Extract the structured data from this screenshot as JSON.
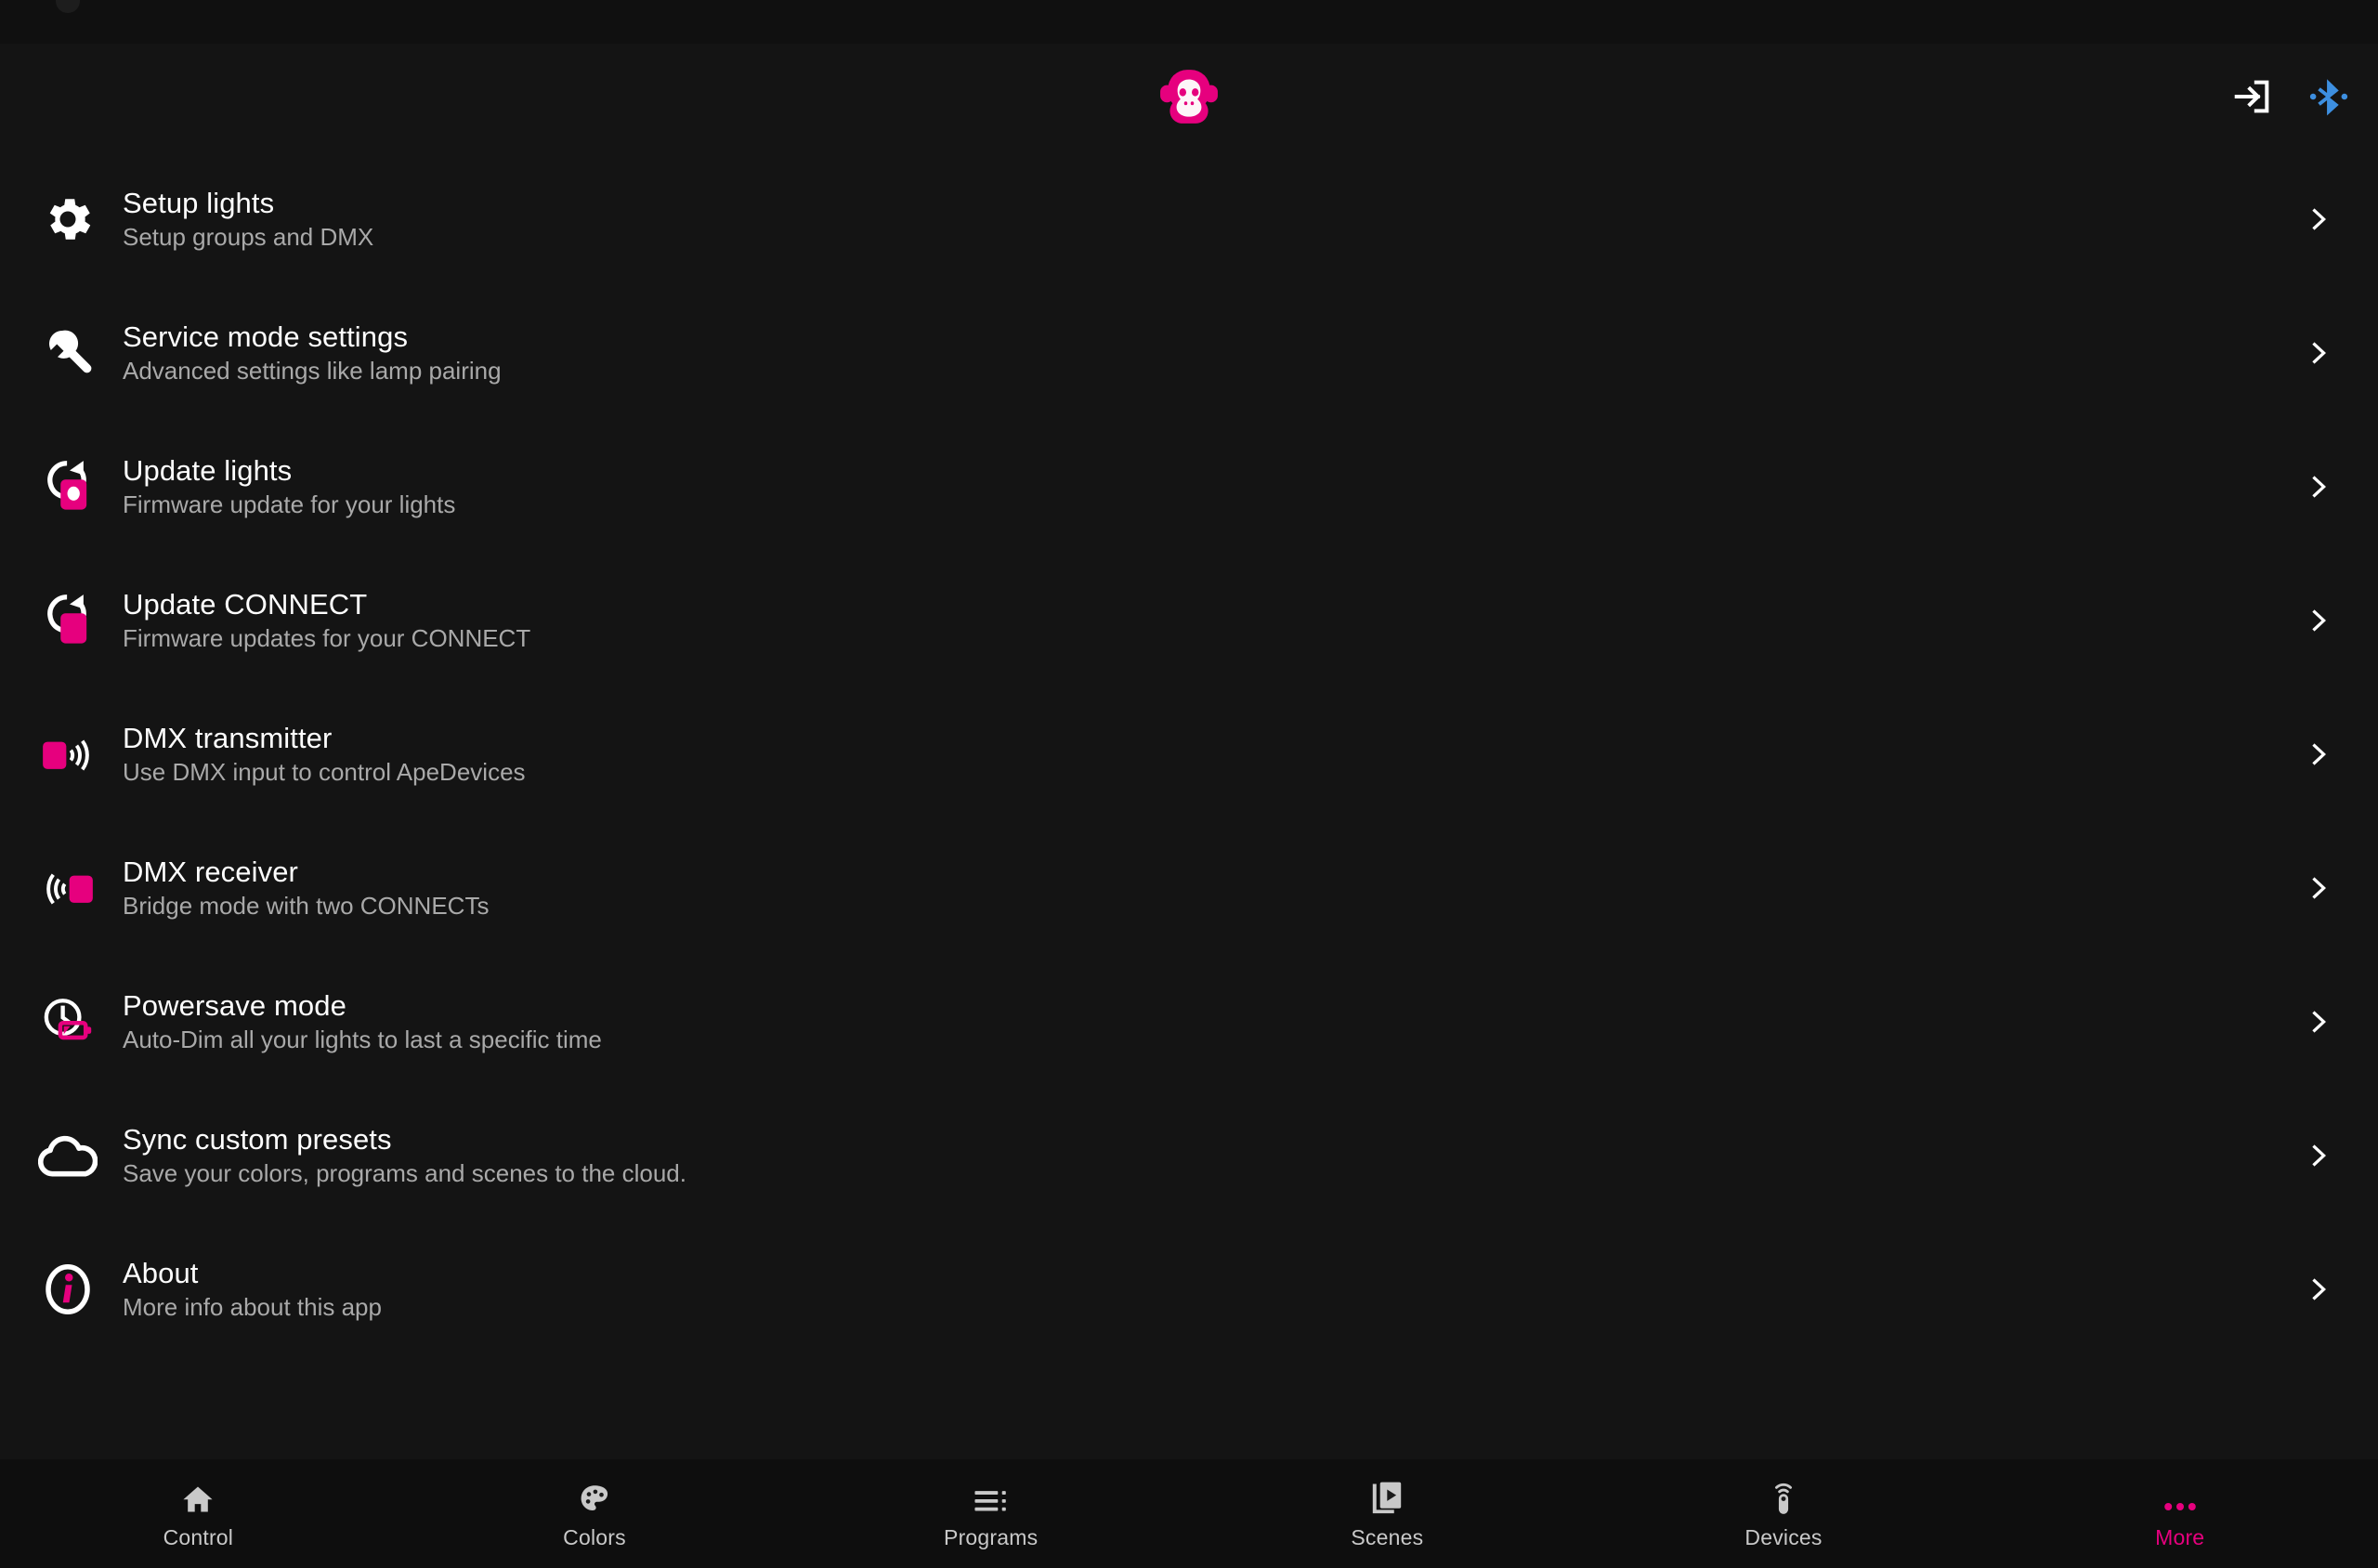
{
  "app": {
    "brand_logo": "ape-monkey-logo",
    "accent_color": "#e6007e",
    "background_color": "#141414",
    "navbar_color": "#0e0e0e",
    "bluetooth_color": "#3d8fe0",
    "title_color": "#ffffff",
    "subtitle_color": "#a9a9a9"
  },
  "header": {
    "logo_name": "ape-labs-logo",
    "actions": [
      {
        "name": "login-icon",
        "label": "Login",
        "color": "#ffffff"
      },
      {
        "name": "bluetooth-icon",
        "label": "Bluetooth",
        "color": "#3d8fe0"
      }
    ]
  },
  "list": {
    "items": [
      {
        "icon": "gear-icon",
        "title": "Setup lights",
        "subtitle": "Setup groups and DMX",
        "chevron": "chevron-right-icon"
      },
      {
        "icon": "wrench-icon",
        "title": "Service mode settings",
        "subtitle": "Advanced settings like lamp pairing",
        "chevron": "chevron-right-icon"
      },
      {
        "icon": "update-light-icon",
        "title": "Update lights",
        "subtitle": "Firmware update for your lights",
        "chevron": "chevron-right-icon"
      },
      {
        "icon": "update-connect-icon",
        "title": "Update CONNECT",
        "subtitle": "Firmware updates for your CONNECT",
        "chevron": "chevron-right-icon"
      },
      {
        "icon": "dmx-transmitter-icon",
        "title": "DMX transmitter",
        "subtitle": "Use DMX input to control ApeDevices",
        "chevron": "chevron-right-icon"
      },
      {
        "icon": "dmx-receiver-icon",
        "title": "DMX receiver",
        "subtitle": "Bridge mode with two CONNECTs",
        "chevron": "chevron-right-icon"
      },
      {
        "icon": "powersave-icon",
        "title": "Powersave mode",
        "subtitle": "Auto-Dim all your lights to last a specific time",
        "chevron": "chevron-right-icon"
      },
      {
        "icon": "cloud-icon",
        "title": "Sync custom presets",
        "subtitle": "Save your colors, programs and scenes to the cloud.",
        "chevron": "chevron-right-icon"
      },
      {
        "icon": "info-icon",
        "title": "About",
        "subtitle": "More info about this app",
        "chevron": "chevron-right-icon"
      }
    ]
  },
  "navbar": {
    "items": [
      {
        "icon": "home-icon",
        "label": "Control",
        "active": false
      },
      {
        "icon": "palette-icon",
        "label": "Colors",
        "active": false
      },
      {
        "icon": "list-icon",
        "label": "Programs",
        "active": false
      },
      {
        "icon": "scenes-icon",
        "label": "Scenes",
        "active": false
      },
      {
        "icon": "remote-icon",
        "label": "Devices",
        "active": false
      },
      {
        "icon": "ellipsis-icon",
        "label": "More",
        "active": true
      }
    ]
  }
}
